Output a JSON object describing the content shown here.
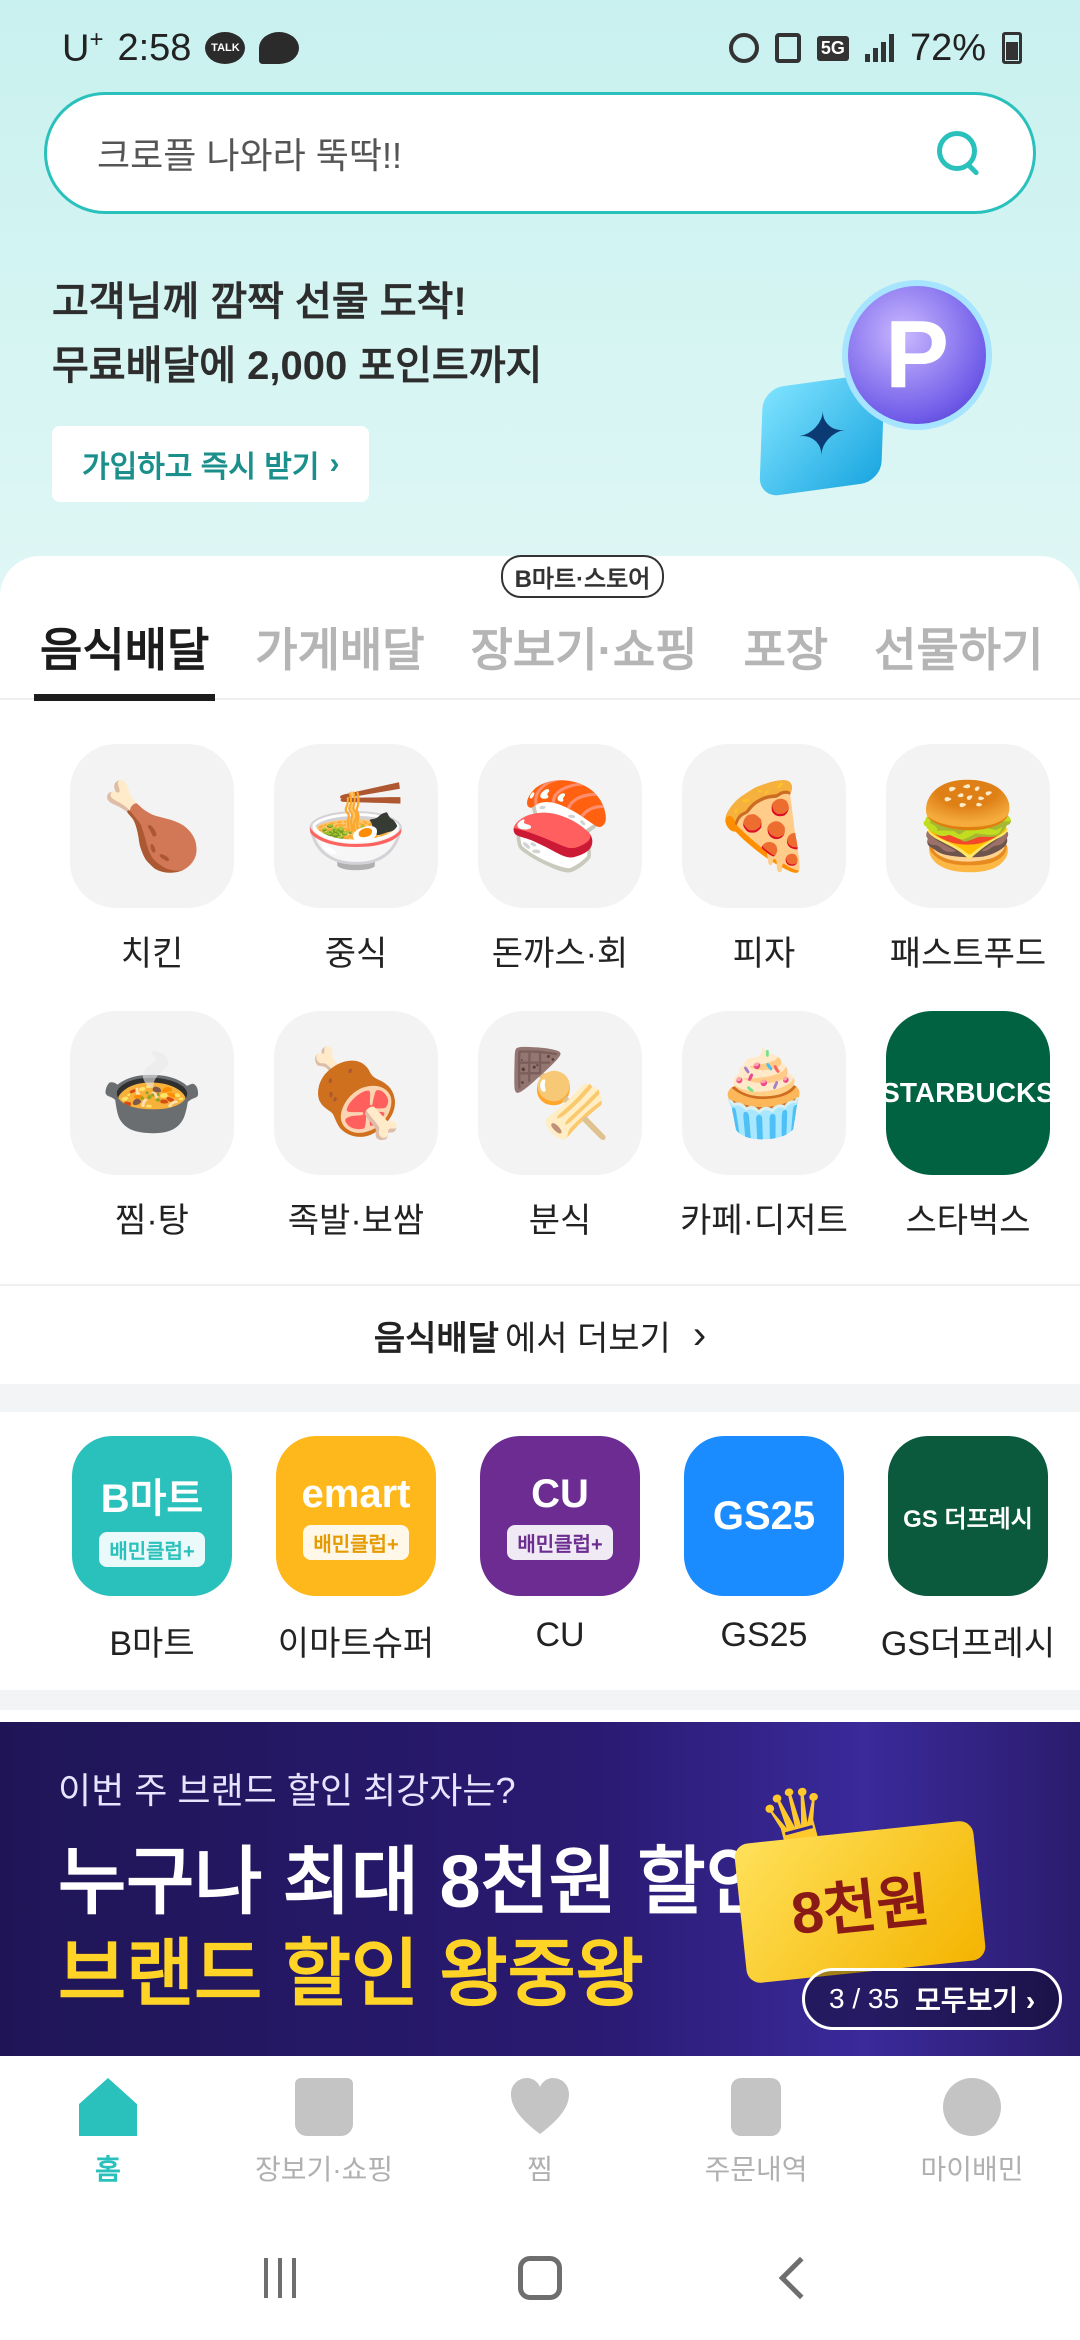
{
  "status": {
    "carrier": "U",
    "carrier_sup": "+",
    "time": "2:58",
    "talk": "TALK",
    "network": "5G",
    "battery": "72%"
  },
  "search": {
    "placeholder": "크로플 나와라 뚝딱!!"
  },
  "promo": {
    "line1": "고객님께 깜짝 선물 도착!",
    "line2": "무료배달에 2,000 포인트까지",
    "button": "가입하고 즉시 받기",
    "coin_letter": "P",
    "gem_symbol": "✦"
  },
  "tabs": {
    "badge": "B마트·스토어",
    "items": [
      {
        "label": "음식배달"
      },
      {
        "label": "가게배달"
      },
      {
        "label": "장보기·쇼핑"
      },
      {
        "label": "포장"
      },
      {
        "label": "선물하기"
      }
    ]
  },
  "categories": [
    {
      "label": "치킨",
      "emoji": "🍗"
    },
    {
      "label": "중식",
      "emoji": "🍜"
    },
    {
      "label": "돈까스·회",
      "emoji": "🍣"
    },
    {
      "label": "피자",
      "emoji": "🍕"
    },
    {
      "label": "패스트푸드",
      "emoji": "🍔"
    },
    {
      "label": "찜·탕",
      "emoji": "🍲"
    },
    {
      "label": "족발·보쌈",
      "emoji": "🍖"
    },
    {
      "label": "분식",
      "emoji": "🍢"
    },
    {
      "label": "카페·디저트",
      "emoji": "🧁"
    },
    {
      "label": "스타벅스",
      "emoji": "STARBUCKS"
    }
  ],
  "more": {
    "bold": "음식배달",
    "rest": "에서 더보기",
    "chevron": "›"
  },
  "stores": [
    {
      "label": "B마트",
      "main": "B마트",
      "sub": "배민클럽+",
      "color": "#2ac1bc"
    },
    {
      "label": "이마트슈퍼",
      "main": "emart",
      "sub": "배민클럽+",
      "color": "#ffb81c"
    },
    {
      "label": "CU",
      "main": "CU",
      "sub": "배민클럽+",
      "color": "#6c2c91"
    },
    {
      "label": "GS25",
      "main": "GS25",
      "sub": "",
      "color": "#1a8cff"
    },
    {
      "label": "GS더프레시",
      "main": "GS 더프레시",
      "sub": "",
      "color": "#0b5a3e"
    }
  ],
  "banner": {
    "subtitle": "이번 주 브랜드 할인 최강자는?",
    "title": "누구나 최대 8천원 할인!",
    "title2": "브랜드 할인 왕중왕",
    "ticket": "8천원",
    "pager_count": "3 / 35",
    "pager_all": "모두보기 ›"
  },
  "bottomnav": [
    {
      "label": "홈"
    },
    {
      "label": "장보기·쇼핑"
    },
    {
      "label": "찜"
    },
    {
      "label": "주문내역"
    },
    {
      "label": "마이배민"
    }
  ]
}
